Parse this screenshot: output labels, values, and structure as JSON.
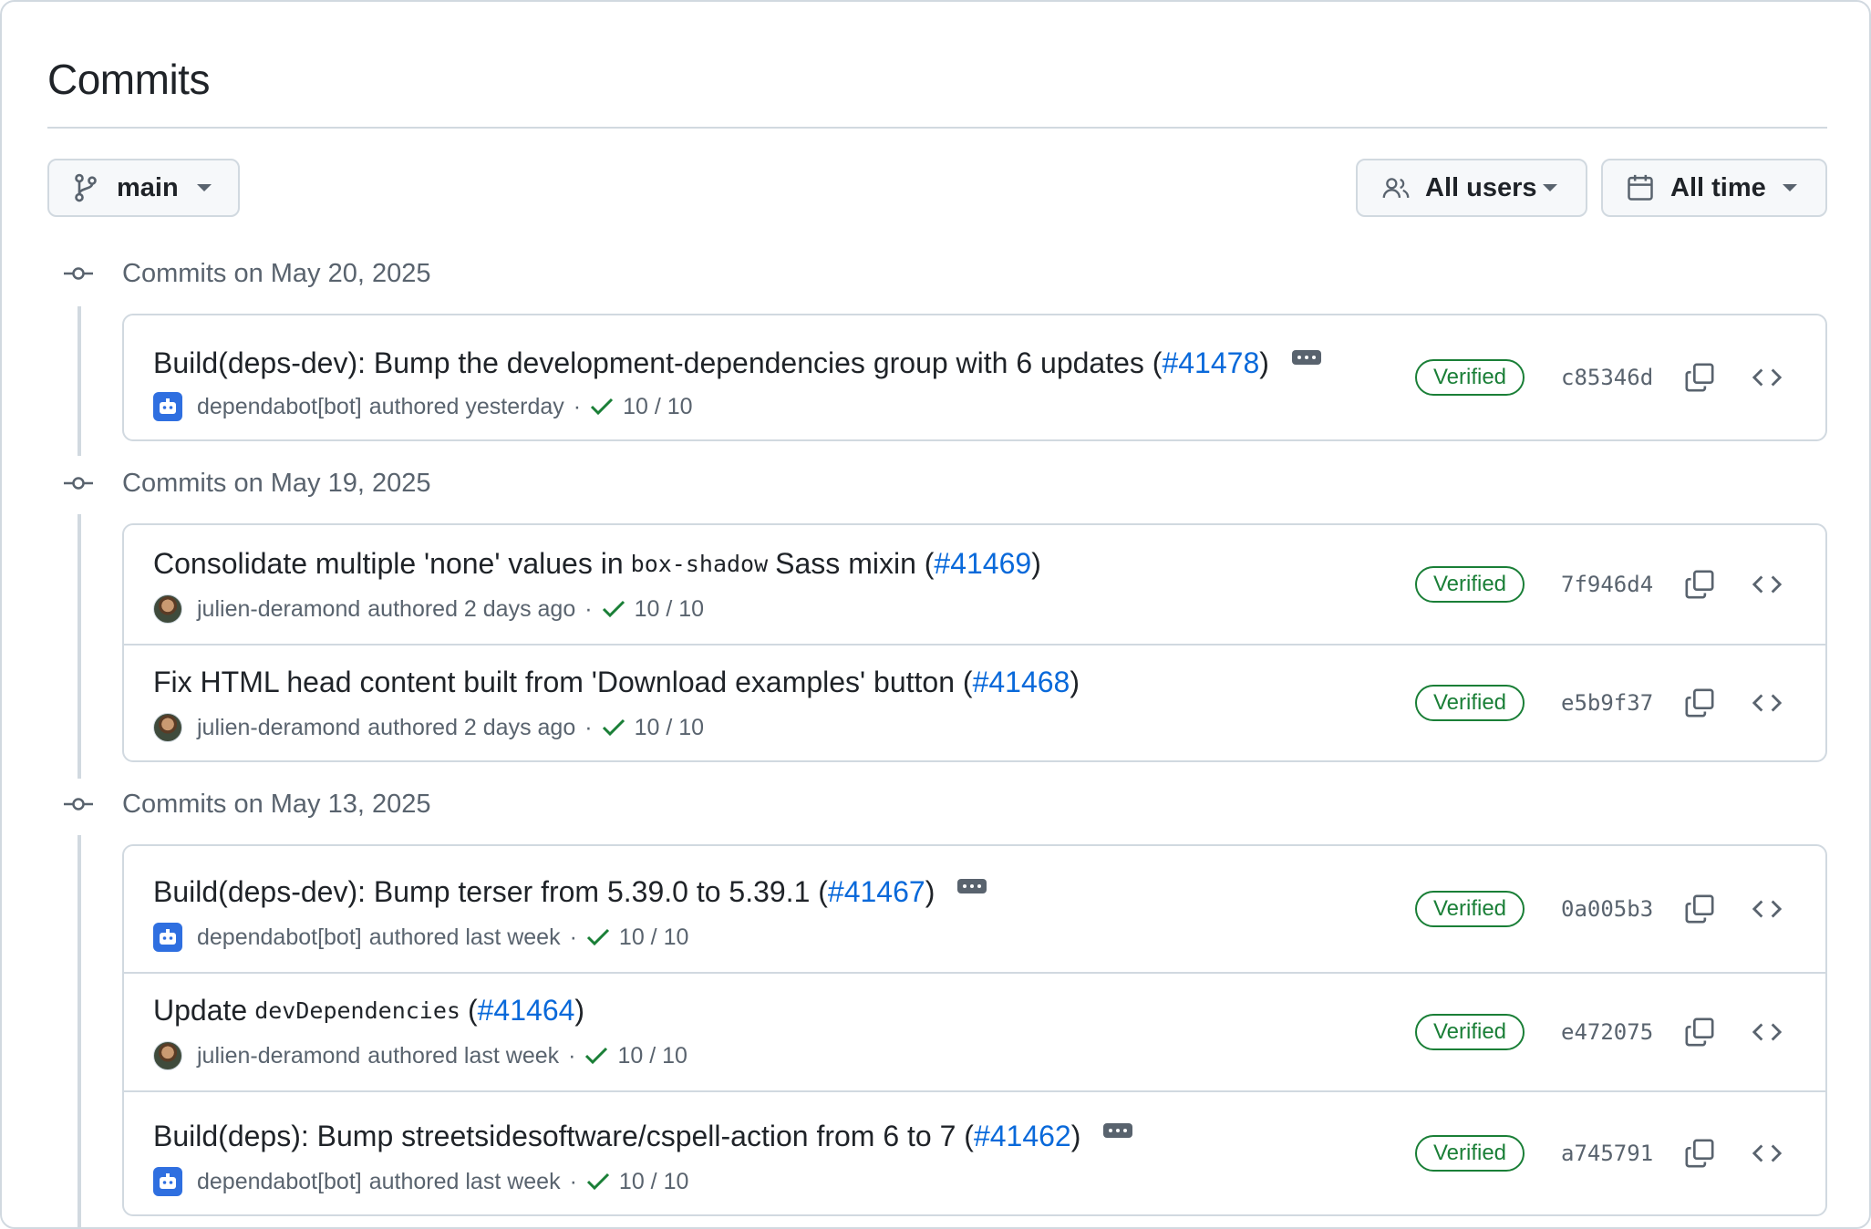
{
  "page": {
    "title": "Commits"
  },
  "filters": {
    "branch": {
      "label": "main",
      "icon": "git-branch-icon"
    },
    "users": {
      "label": "All users",
      "icon": "people-icon"
    },
    "time": {
      "label": "All time",
      "icon": "calendar-icon"
    }
  },
  "groups": [
    {
      "heading": "Commits on May 20, 2025",
      "commits": [
        {
          "title_parts": [
            "Build(deps-dev): Bump the development-dependencies group with 6 updates (",
            "",
            ")"
          ],
          "code": "",
          "pr": "#41478",
          "has_ellipsis": true,
          "avatar": "bot",
          "author": "dependabot[bot]",
          "authored": "authored yesterday",
          "checks": "10 / 10",
          "badge": "Verified",
          "sha": "c85346d"
        }
      ]
    },
    {
      "heading": "Commits on May 19, 2025",
      "commits": [
        {
          "pre": "Consolidate multiple 'none' values in",
          "code": "box-shadow",
          "post": "Sass mixin (",
          "pr": "#41469",
          "end": ")",
          "has_ellipsis": false,
          "avatar": "user",
          "author": "julien-deramond",
          "authored": "authored 2 days ago",
          "checks": "10 / 10",
          "badge": "Verified",
          "sha": "7f946d4"
        },
        {
          "pre": "Fix HTML head content built from 'Download examples' button (",
          "code": "",
          "post": "",
          "pr": "#41468",
          "end": ")",
          "has_ellipsis": false,
          "avatar": "user",
          "author": "julien-deramond",
          "authored": "authored 2 days ago",
          "checks": "10 / 10",
          "badge": "Verified",
          "sha": "e5b9f37"
        }
      ]
    },
    {
      "heading": "Commits on May 13, 2025",
      "commits": [
        {
          "pre": "Build(deps-dev): Bump terser from 5.39.0 to 5.39.1 (",
          "code": "",
          "post": "",
          "pr": "#41467",
          "end": ")",
          "has_ellipsis": true,
          "avatar": "bot",
          "author": "dependabot[bot]",
          "authored": "authored last week",
          "checks": "10 / 10",
          "badge": "Verified",
          "sha": "0a005b3"
        },
        {
          "pre": "Update",
          "code": "devDependencies",
          "post": "(",
          "pr": "#41464",
          "end": ")",
          "has_ellipsis": false,
          "avatar": "user",
          "author": "julien-deramond",
          "authored": "authored last week",
          "checks": "10 / 10",
          "badge": "Verified",
          "sha": "e472075"
        },
        {
          "pre": "Build(deps): Bump streetsidesoftware/cspell-action from 6 to 7 (",
          "code": "",
          "post": "",
          "pr": "#41462",
          "end": ")",
          "has_ellipsis": true,
          "avatar": "bot",
          "author": "dependabot[bot]",
          "authored": "authored last week",
          "checks": "10 / 10",
          "badge": "Verified",
          "sha": "a745791"
        }
      ]
    }
  ],
  "meta_separator": "·"
}
